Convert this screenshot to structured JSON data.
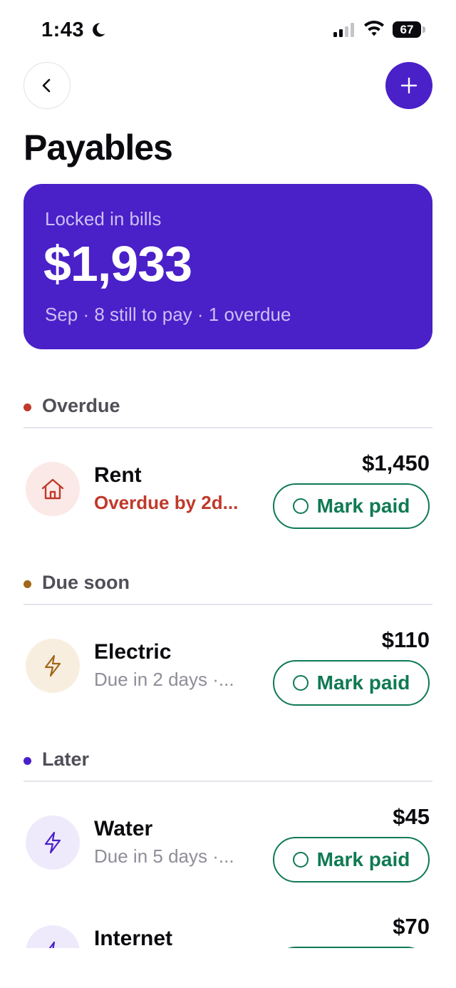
{
  "status_bar": {
    "time": "1:43",
    "battery": "67"
  },
  "header": {
    "title": "Payables"
  },
  "summary": {
    "label": "Locked in bills",
    "amount": "$1,933",
    "meta": "Sep · 8 still to pay · 1 overdue"
  },
  "sections": [
    {
      "title": "Overdue",
      "dot_color": "#c0392b"
    },
    {
      "title": "Due soon",
      "dot_color": "#a0661a"
    },
    {
      "title": "Later",
      "dot_color": "#4a20c8"
    }
  ],
  "bills": [
    {
      "name": "Rent",
      "status": "Overdue by 2d...",
      "amount": "$1,450",
      "button": "Mark paid",
      "icon": "house-icon"
    },
    {
      "name": "Electric",
      "status": "Due in 2 days ·...",
      "amount": "$110",
      "button": "Mark paid",
      "icon": "lightning-icon"
    },
    {
      "name": "Water",
      "status": "Due in 5 days ·...",
      "amount": "$45",
      "button": "Mark paid",
      "icon": "lightning-icon"
    },
    {
      "name": "Internet",
      "amount": "$70",
      "icon": "lightning-icon"
    }
  ],
  "colors": {
    "accent": "#4a20c8",
    "success": "#0f7a52",
    "danger": "#c0392b",
    "muted": "#8e8e99"
  }
}
